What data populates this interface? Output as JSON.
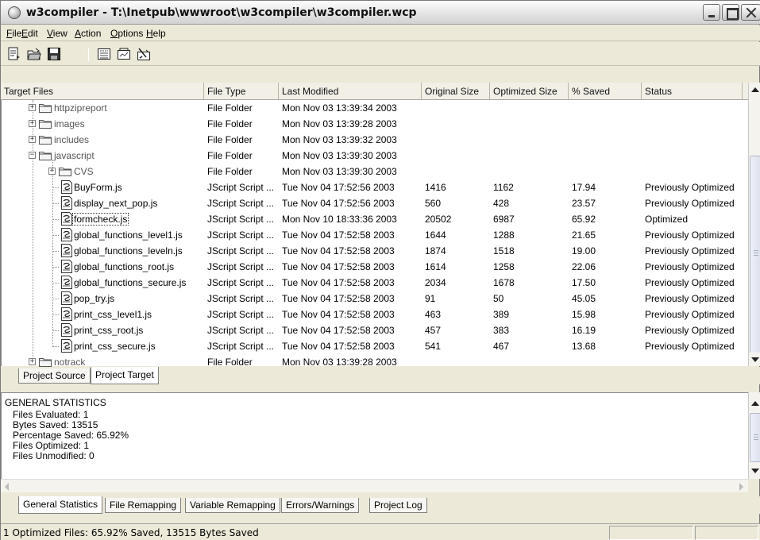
{
  "window": {
    "title": "w3compiler - T:\\Inetpub\\wwwroot\\w3compiler\\w3compiler.wcp",
    "app_icon": "w3compiler-globe-icon"
  },
  "menu": [
    "File",
    "Edit",
    "View",
    "Action",
    "Options",
    "Help"
  ],
  "menu_mnemonics": [
    "F",
    "E",
    "V",
    "A",
    "O",
    "H"
  ],
  "toolbar": {
    "icons": [
      "new-project-icon",
      "open-folder-icon",
      "save-icon",
      "compile-icon",
      "optimize-icon",
      "clean-icon"
    ]
  },
  "table": {
    "columns": [
      "Target Files",
      "File Type",
      "Last Modified",
      "Original Size",
      "Optimized Size",
      "% Saved",
      "Status"
    ],
    "rows": [
      {
        "name": "httpzipreport",
        "kind": "folder",
        "depth": 1,
        "expander": "+",
        "type": "File Folder",
        "modified": "Mon Nov 03 13:39:34 2003",
        "original": "",
        "optimized": "",
        "saved": "",
        "status": ""
      },
      {
        "name": "images",
        "kind": "folder",
        "depth": 1,
        "expander": "+",
        "type": "File Folder",
        "modified": "Mon Nov 03 13:39:28 2003",
        "original": "",
        "optimized": "",
        "saved": "",
        "status": ""
      },
      {
        "name": "includes",
        "kind": "folder",
        "depth": 1,
        "expander": "+",
        "type": "File Folder",
        "modified": "Mon Nov 03 13:39:32 2003",
        "original": "",
        "optimized": "",
        "saved": "",
        "status": ""
      },
      {
        "name": "javascript",
        "kind": "folder",
        "depth": 1,
        "expander": "−",
        "type": "File Folder",
        "modified": "Mon Nov 03 13:39:30 2003",
        "original": "",
        "optimized": "",
        "saved": "",
        "status": ""
      },
      {
        "name": "CVS",
        "kind": "folder",
        "depth": 2,
        "expander": "+",
        "type": "File Folder",
        "modified": "Mon Nov 03 13:39:30 2003",
        "original": "",
        "optimized": "",
        "saved": "",
        "status": ""
      },
      {
        "name": "BuyForm.js",
        "kind": "file",
        "depth": 2,
        "expander": "",
        "type": "JScript Script ...",
        "modified": "Tue Nov 04 17:52:56 2003",
        "original": "1416",
        "optimized": "1162",
        "saved": "17.94",
        "status": "Previously Optimized"
      },
      {
        "name": "display_next_pop.js",
        "kind": "file",
        "depth": 2,
        "expander": "",
        "type": "JScript Script ...",
        "modified": "Tue Nov 04 17:52:56 2003",
        "original": "560",
        "optimized": "428",
        "saved": "23.57",
        "status": "Previously Optimized"
      },
      {
        "name": "formcheck.js",
        "kind": "file",
        "depth": 2,
        "expander": "",
        "type": "JScript Script ...",
        "modified": "Mon Nov 10 18:33:36 2003",
        "original": "20502",
        "optimized": "6987",
        "saved": "65.92",
        "status": "Optimized",
        "selected": true
      },
      {
        "name": "global_functions_level1.js",
        "kind": "file",
        "depth": 2,
        "expander": "",
        "type": "JScript Script ...",
        "modified": "Tue Nov 04 17:52:58 2003",
        "original": "1644",
        "optimized": "1288",
        "saved": "21.65",
        "status": "Previously Optimized"
      },
      {
        "name": "global_functions_leveln.js",
        "kind": "file",
        "depth": 2,
        "expander": "",
        "type": "JScript Script ...",
        "modified": "Tue Nov 04 17:52:58 2003",
        "original": "1874",
        "optimized": "1518",
        "saved": "19.00",
        "status": "Previously Optimized"
      },
      {
        "name": "global_functions_root.js",
        "kind": "file",
        "depth": 2,
        "expander": "",
        "type": "JScript Script ...",
        "modified": "Tue Nov 04 17:52:58 2003",
        "original": "1614",
        "optimized": "1258",
        "saved": "22.06",
        "status": "Previously Optimized"
      },
      {
        "name": "global_functions_secure.js",
        "kind": "file",
        "depth": 2,
        "expander": "",
        "type": "JScript Script ...",
        "modified": "Tue Nov 04 17:52:58 2003",
        "original": "2034",
        "optimized": "1678",
        "saved": "17.50",
        "status": "Previously Optimized"
      },
      {
        "name": "pop_try.js",
        "kind": "file",
        "depth": 2,
        "expander": "",
        "type": "JScript Script ...",
        "modified": "Tue Nov 04 17:52:58 2003",
        "original": "91",
        "optimized": "50",
        "saved": "45.05",
        "status": "Previously Optimized"
      },
      {
        "name": "print_css_level1.js",
        "kind": "file",
        "depth": 2,
        "expander": "",
        "type": "JScript Script ...",
        "modified": "Tue Nov 04 17:52:58 2003",
        "original": "463",
        "optimized": "389",
        "saved": "15.98",
        "status": "Previously Optimized"
      },
      {
        "name": "print_css_root.js",
        "kind": "file",
        "depth": 2,
        "expander": "",
        "type": "JScript Script ...",
        "modified": "Tue Nov 04 17:52:58 2003",
        "original": "457",
        "optimized": "383",
        "saved": "16.19",
        "status": "Previously Optimized"
      },
      {
        "name": "print_css_secure.js",
        "kind": "file",
        "depth": 2,
        "expander": "",
        "type": "JScript Script ...",
        "modified": "Tue Nov 04 17:52:58 2003",
        "original": "541",
        "optimized": "467",
        "saved": "13.68",
        "status": "Previously Optimized"
      },
      {
        "name": "notrack",
        "kind": "folder",
        "depth": 1,
        "expander": "+",
        "type": "File Folder",
        "modified": "Mon Nov 03 13:39:28 2003",
        "original": "",
        "optimized": "",
        "saved": "",
        "status": ""
      }
    ]
  },
  "project_tabs": [
    "Project Source",
    "Project Target"
  ],
  "project_tabs_active": 1,
  "stats": {
    "heading": "GENERAL STATISTICS",
    "lines": [
      "Files Evaluated: 1",
      "Bytes Saved: 13515",
      "Percentage Saved: 65.92%",
      "Files Optimized: 1",
      "Files Unmodified: 0"
    ]
  },
  "bottom_tabs": [
    "General Statistics",
    "File Remapping",
    "Variable Remapping",
    "Errors/Warnings",
    "Project Log"
  ],
  "bottom_tabs_active": 0,
  "status_bar": {
    "text": "1 Optimized Files: 65.92% Saved, 13515 Bytes Saved"
  },
  "colors": {
    "window_bg": "#ece9d8",
    "folder": "#f0d78a",
    "selection_outline": "#333333"
  }
}
